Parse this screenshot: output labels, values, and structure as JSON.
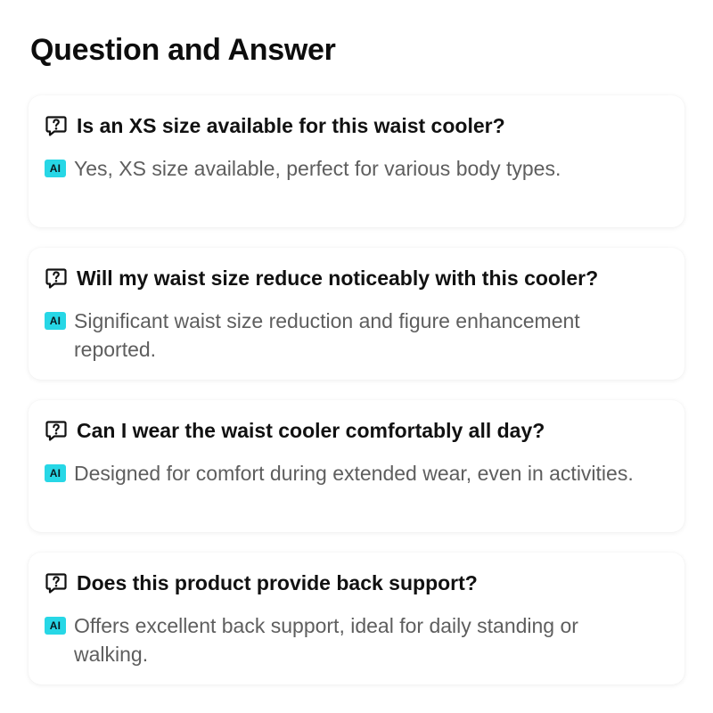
{
  "page": {
    "title": "Question and Answer"
  },
  "colors": {
    "ai_badge_bg": "#27d7e6",
    "question_text": "#111111",
    "answer_text": "#5e5e5e"
  },
  "qa": [
    {
      "question_icon": "question-bubble-icon",
      "question": "Is an XS size available for this waist cooler?",
      "ai_badge": "AI",
      "answer": "Yes, XS size available, perfect for various body types."
    },
    {
      "question_icon": "question-bubble-icon",
      "question": "Will my waist size reduce noticeably with this cooler?",
      "ai_badge": "AI",
      "answer": "Significant waist size reduction and figure enhancement reported."
    },
    {
      "question_icon": "question-bubble-icon",
      "question": "Can I wear the waist cooler comfortably all day?",
      "ai_badge": "AI",
      "answer": "Designed for comfort during extended wear, even in activities."
    },
    {
      "question_icon": "question-bubble-icon",
      "question": "Does this product provide back support?",
      "ai_badge": "AI",
      "answer": "Offers excellent back support, ideal for daily standing or walking."
    }
  ]
}
